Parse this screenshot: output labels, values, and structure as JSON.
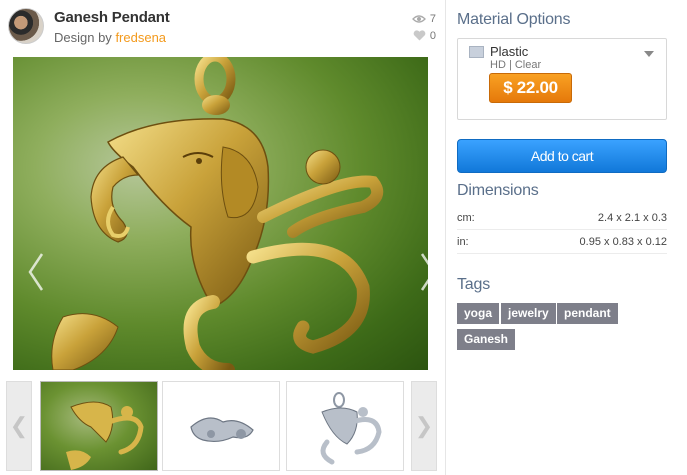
{
  "product": {
    "title": "Ganesh Pendant",
    "design_by_prefix": "Design by",
    "author": "fredsena",
    "views": "7",
    "likes": "0"
  },
  "gallery": {
    "prev_icon": "chevron-left-icon",
    "next_icon": "chevron-right-icon",
    "thumb_prev_glyph": "❮",
    "thumb_next_glyph": "❯"
  },
  "material": {
    "section_title": "Material Options",
    "name": "Plastic",
    "subtitle": "HD | Clear",
    "price": "$ 22.00"
  },
  "cart": {
    "label": "Add to cart"
  },
  "dimensions": {
    "section_title": "Dimensions",
    "rows": [
      {
        "unit": "cm:",
        "value": "2.4 x 2.1 x 0.3"
      },
      {
        "unit": "in:",
        "value": "0.95 x 0.83 x 0.12"
      }
    ]
  },
  "tags": {
    "section_title": "Tags",
    "items": [
      "yoga",
      "jewelry",
      "pendant",
      "Ganesh"
    ]
  },
  "colors": {
    "accent_orange": "#f39a1d",
    "button_blue": "#1178d9",
    "heading_blue": "#5a6f8a",
    "tag_gray": "#7e7f8a"
  }
}
